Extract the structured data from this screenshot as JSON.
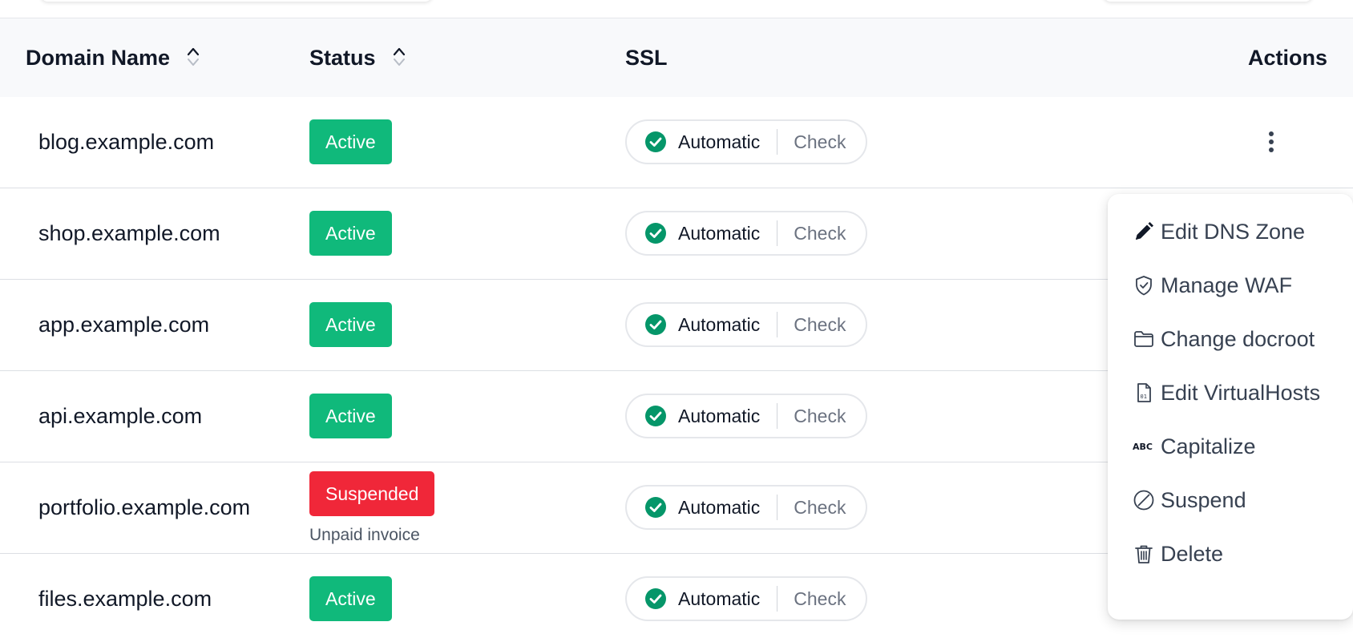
{
  "table": {
    "columns": {
      "domain": "Domain Name",
      "status": "Status",
      "ssl": "SSL",
      "actions": "Actions"
    },
    "rows": [
      {
        "domain": "blog.example.com",
        "status": "Active",
        "status_note": "",
        "ssl_mode": "Automatic",
        "ssl_action": "Check"
      },
      {
        "domain": "shop.example.com",
        "status": "Active",
        "status_note": "",
        "ssl_mode": "Automatic",
        "ssl_action": "Check"
      },
      {
        "domain": "app.example.com",
        "status": "Active",
        "status_note": "",
        "ssl_mode": "Automatic",
        "ssl_action": "Check"
      },
      {
        "domain": "api.example.com",
        "status": "Active",
        "status_note": "",
        "ssl_mode": "Automatic",
        "ssl_action": "Check"
      },
      {
        "domain": "portfolio.example.com",
        "status": "Suspended",
        "status_note": "Unpaid invoice",
        "ssl_mode": "Automatic",
        "ssl_action": "Check"
      },
      {
        "domain": "files.example.com",
        "status": "Active",
        "status_note": "",
        "ssl_mode": "Automatic",
        "ssl_action": "Check"
      }
    ]
  },
  "actions_menu": {
    "items": [
      {
        "label": "Edit DNS Zone",
        "icon": "pencil-icon"
      },
      {
        "label": "Manage WAF",
        "icon": "shield-check-icon"
      },
      {
        "label": "Change docroot",
        "icon": "folder-icon"
      },
      {
        "label": "Edit VirtualHosts",
        "icon": "file-code-icon"
      },
      {
        "label": "Capitalize",
        "icon": "abc-icon"
      },
      {
        "label": "Suspend",
        "icon": "slash-circle-icon"
      },
      {
        "label": "Delete",
        "icon": "trash-icon"
      }
    ]
  },
  "colors": {
    "active": "#10b97b",
    "suspended": "#f02739",
    "ssl_ok": "#059669",
    "header_bg": "#f8f9fb"
  }
}
